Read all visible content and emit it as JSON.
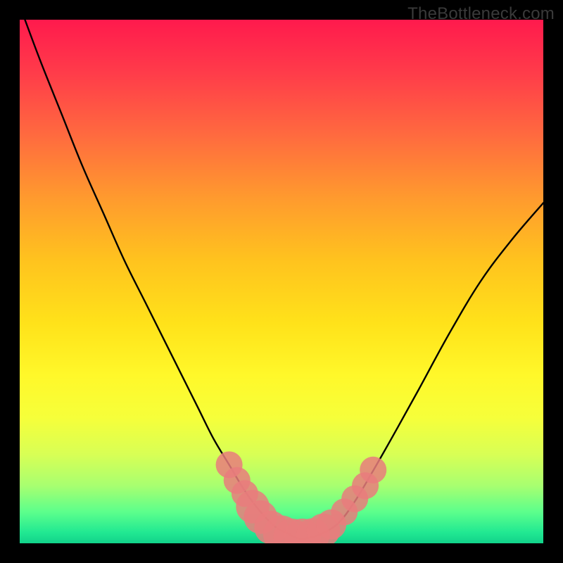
{
  "watermark": "TheBottleneck.com",
  "colors": {
    "frame_background": "#000000",
    "watermark_text": "#3a3a3a",
    "curve_stroke": "#000000",
    "marker_fill": "#e97d7d",
    "gradient_stops": [
      "#ff1a4d",
      "#ff3b4a",
      "#ff6a3f",
      "#ff9a2e",
      "#ffc31e",
      "#ffe21a",
      "#fff82a",
      "#f6ff3a",
      "#d8ff55",
      "#a8ff70",
      "#5cff8c",
      "#20e892",
      "#12d28a"
    ]
  },
  "chart_data": {
    "type": "line",
    "title": "",
    "xlabel": "",
    "ylabel": "",
    "xlim": [
      0,
      100
    ],
    "ylim": [
      0,
      100
    ],
    "note": "Bottleneck-style V-curve plotted over a vertical rainbow gradient. Labeled axes are absent; data is approximated by tracing the curve geometry and marker positions in normalized 0–100 space.",
    "series": [
      {
        "name": "curve",
        "x": [
          1,
          4,
          8,
          12,
          16,
          20,
          24,
          28,
          31,
          34,
          37,
          40,
          43,
          46,
          49,
          51,
          53,
          55,
          58,
          61,
          64,
          67,
          71,
          76,
          82,
          88,
          94,
          100
        ],
        "y": [
          100,
          92,
          82,
          72,
          63,
          54,
          46,
          38,
          32,
          26,
          20,
          15,
          10,
          6,
          3,
          2,
          1,
          1,
          2,
          4,
          8,
          13,
          20,
          29,
          40,
          50,
          58,
          65
        ]
      }
    ],
    "markers": [
      {
        "x": 40.0,
        "y": 15.0,
        "r": 1.6
      },
      {
        "x": 41.5,
        "y": 12.0,
        "r": 1.6
      },
      {
        "x": 43.0,
        "y": 9.5,
        "r": 1.6
      },
      {
        "x": 44.5,
        "y": 7.0,
        "r": 2.0
      },
      {
        "x": 46.0,
        "y": 5.0,
        "r": 2.0
      },
      {
        "x": 48.0,
        "y": 3.0,
        "r": 2.0
      },
      {
        "x": 50.0,
        "y": 1.8,
        "r": 2.2
      },
      {
        "x": 52.0,
        "y": 1.2,
        "r": 2.2
      },
      {
        "x": 54.0,
        "y": 1.2,
        "r": 2.2
      },
      {
        "x": 56.0,
        "y": 1.6,
        "r": 2.0
      },
      {
        "x": 58.0,
        "y": 2.5,
        "r": 2.0
      },
      {
        "x": 59.5,
        "y": 3.6,
        "r": 1.8
      },
      {
        "x": 62.0,
        "y": 6.0,
        "r": 1.6
      },
      {
        "x": 64.0,
        "y": 8.5,
        "r": 1.6
      },
      {
        "x": 66.0,
        "y": 11.0,
        "r": 1.6
      },
      {
        "x": 67.5,
        "y": 14.0,
        "r": 1.6
      }
    ]
  }
}
